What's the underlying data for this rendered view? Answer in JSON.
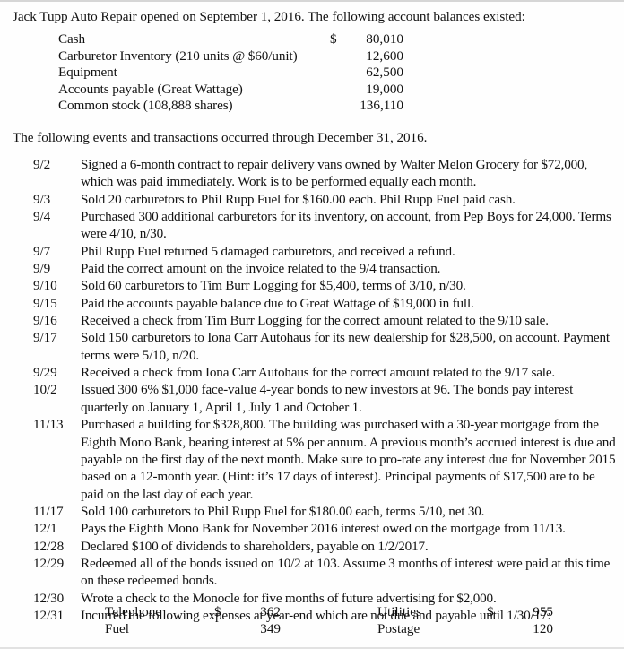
{
  "document": {
    "intro_line": "Jack Tupp Auto Repair opened on September 1, 2016.  The following account balances existed:",
    "events_intro": "The following events and transactions occurred through December 31, 2016."
  },
  "opening_balances": {
    "rows": [
      {
        "label": "Cash",
        "dollar": "$",
        "amount": "80,010"
      },
      {
        "label": "Carburetor Inventory (210 units @ $60/unit)",
        "dollar": "",
        "amount": "12,600"
      },
      {
        "label": "Equipment",
        "dollar": "",
        "amount": "62,500"
      },
      {
        "label": "Accounts payable (Great Wattage)",
        "dollar": "",
        "amount": "19,000"
      },
      {
        "label": "Common stock (108,888 shares)",
        "dollar": "",
        "amount": "136,110"
      }
    ]
  },
  "transactions": [
    {
      "date": "9/2",
      "text": "Signed a 6-month contract to repair delivery vans owned by Walter Melon Grocery for $72,000, which was paid immediately.  Work is to be performed equally each month."
    },
    {
      "date": "9/3",
      "text": "Sold 20 carburetors to Phil Rupp Fuel for $160.00 each. Phil Rupp Fuel paid cash."
    },
    {
      "date": "9/4",
      "text": "Purchased 300 additional carburetors for its inventory, on account, from Pep Boys for 24,000.  Terms were 4/10, n/30."
    },
    {
      "date": "9/7",
      "text": "Phil Rupp Fuel returned 5 damaged carburetors, and received a refund."
    },
    {
      "date": "9/9",
      "text": "Paid the correct amount on the invoice related to the 9/4 transaction."
    },
    {
      "date": "9/10",
      "text": "Sold 60 carburetors to Tim Burr Logging for $5,400, terms of 3/10, n/30."
    },
    {
      "date": "9/15",
      "text": "Paid the accounts payable balance due to Great Wattage of $19,000 in full."
    },
    {
      "date": "9/16",
      "text": "Received a check from Tim Burr Logging for the correct amount related to the 9/10 sale."
    },
    {
      "date": "9/17",
      "text": "Sold 150 carburetors to Iona Carr Autohaus for its new dealership for $28,500, on account. Payment terms were 5/10, n/20."
    },
    {
      "date": "9/29",
      "text": "Received a check from Iona Carr Autohaus for the correct amount related to the 9/17 sale."
    },
    {
      "date": "10/2",
      "text": "Issued 300 6% $1,000 face-value 4-year bonds to new investors at 96.  The bonds pay interest quarterly on January 1, April 1, July 1 and October 1."
    },
    {
      "date": "11/13",
      "text": "Purchased a building for $328,800. The building was purchased with a 30-year mortgage from the Eighth Mono Bank, bearing interest at 5% per annum.  A previous month’s accrued interest is due and payable on the first day of the next month. Make sure to pro-rate any interest due for November 2015 based on a 12-month year. (Hint: it’s 17 days of interest).  Principal payments of $17,500 are to be paid on the last day of each year."
    },
    {
      "date": "11/17",
      "text": "Sold 100 carburetors to Phil Rupp Fuel for $180.00 each, terms 5/10, net 30."
    },
    {
      "date": "12/1",
      "text": "Pays the Eighth Mono Bank for November 2016 interest owed on the mortgage from 11/13."
    },
    {
      "date": "12/28",
      "text": "Declared $100 of dividends to shareholders, payable on 1/2/2017."
    },
    {
      "date": "12/29",
      "text": "Redeemed all of the bonds issued on 10/2 at 103.  Assume 3 months of interest were paid at this time on these redeemed bonds."
    },
    {
      "date": "12/30",
      "text": "Wrote a check to the Monocle for five months of future advertising for $2,000."
    },
    {
      "date": "12/31",
      "text": "Incurred the following expenses at year-end which are not due and payable until 1/30/17:"
    }
  ],
  "year_end_expenses": {
    "rows": [
      {
        "left_label": "Telephone",
        "left_dollar": "$",
        "left_amount": "362",
        "right_label": "Utilities",
        "right_dollar": "$",
        "right_amount": "955"
      },
      {
        "left_label": "Fuel",
        "left_dollar": "",
        "left_amount": "349",
        "right_label": "Postage",
        "right_dollar": "",
        "right_amount": "120"
      }
    ]
  }
}
